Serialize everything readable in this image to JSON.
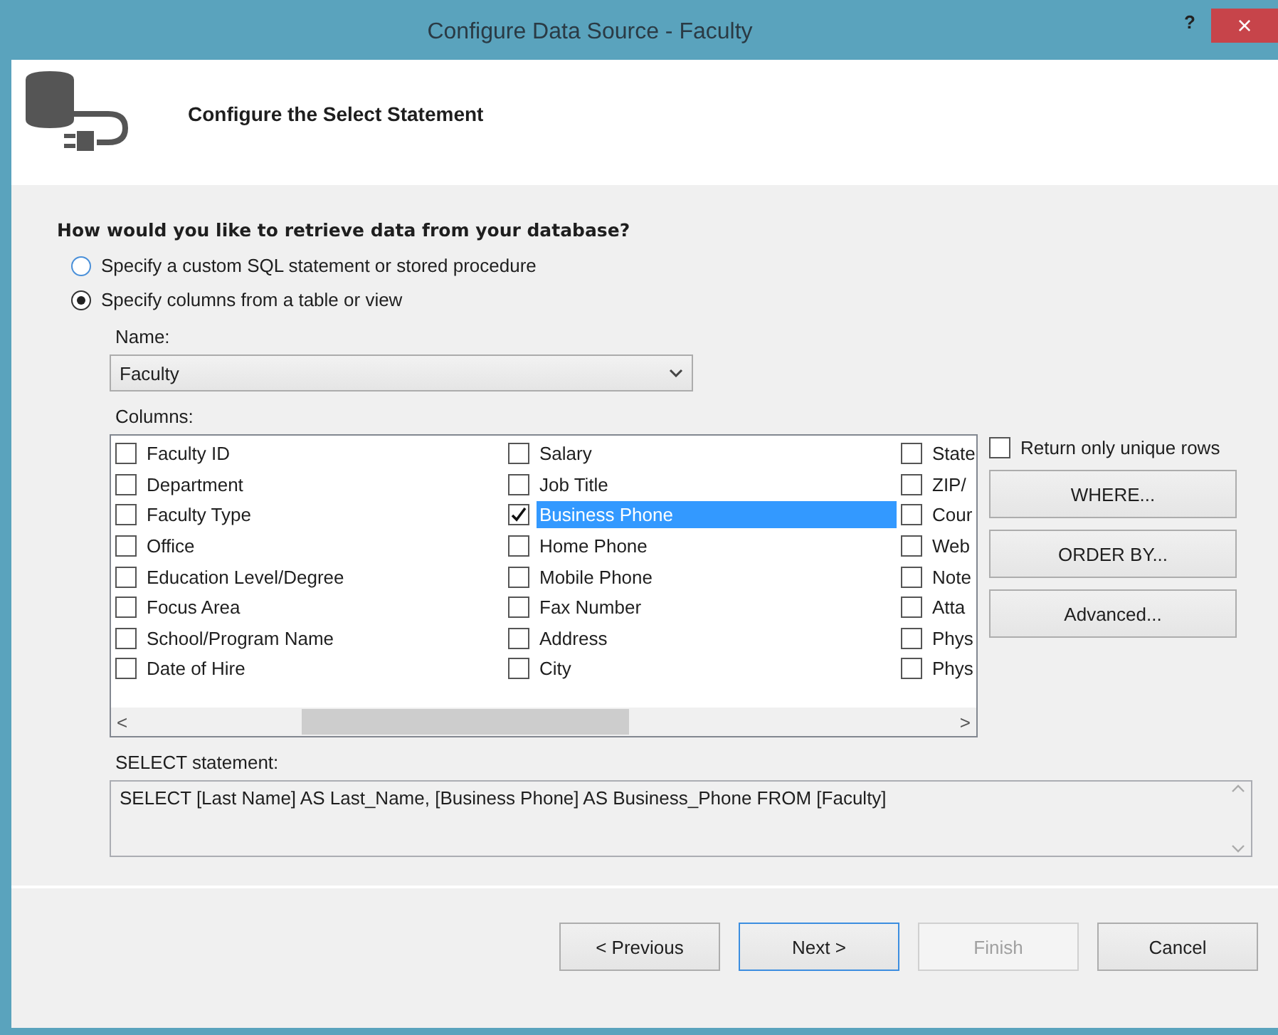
{
  "window": {
    "title": "Configure Data Source - Faculty",
    "help": "?",
    "close": "×"
  },
  "header": {
    "title": "Configure the Select Statement"
  },
  "question": "How would you like to retrieve data from your database?",
  "options": [
    {
      "label": "Specify a custom SQL statement or stored procedure",
      "selected": false
    },
    {
      "label": "Specify columns from a table or view",
      "selected": true
    }
  ],
  "name_label": "Name:",
  "name_field": {
    "value": "Faculty"
  },
  "columns_label": "Columns:",
  "columns": [
    [
      {
        "label": "Faculty ID",
        "checked": false,
        "selected": false
      },
      {
        "label": "Department",
        "checked": false,
        "selected": false
      },
      {
        "label": "Faculty Type",
        "checked": false,
        "selected": false
      },
      {
        "label": "Office",
        "checked": false,
        "selected": false
      },
      {
        "label": "Education Level/Degree",
        "checked": false,
        "selected": false
      },
      {
        "label": "Focus Area",
        "checked": false,
        "selected": false
      },
      {
        "label": "School/Program Name",
        "checked": false,
        "selected": false
      },
      {
        "label": "Date of Hire",
        "checked": false,
        "selected": false
      }
    ],
    [
      {
        "label": "Salary",
        "checked": false,
        "selected": false
      },
      {
        "label": "Job Title",
        "checked": false,
        "selected": false
      },
      {
        "label": "Business Phone",
        "checked": true,
        "selected": true
      },
      {
        "label": "Home Phone",
        "checked": false,
        "selected": false
      },
      {
        "label": "Mobile Phone",
        "checked": false,
        "selected": false
      },
      {
        "label": "Fax Number",
        "checked": false,
        "selected": false
      },
      {
        "label": "Address",
        "checked": false,
        "selected": false
      },
      {
        "label": "City",
        "checked": false,
        "selected": false
      }
    ],
    [
      {
        "label": "State",
        "checked": false,
        "selected": false
      },
      {
        "label": "ZIP/",
        "checked": false,
        "selected": false
      },
      {
        "label": "Cour",
        "checked": false,
        "selected": false
      },
      {
        "label": "Web",
        "checked": false,
        "selected": false
      },
      {
        "label": "Note",
        "checked": false,
        "selected": false
      },
      {
        "label": "Atta",
        "checked": false,
        "selected": false
      },
      {
        "label": "Phys",
        "checked": false,
        "selected": false
      },
      {
        "label": "Phys",
        "checked": false,
        "selected": false
      }
    ]
  ],
  "scroll": {
    "left": "<",
    "right": ">"
  },
  "unique_rows": {
    "label": "Return only unique rows",
    "checked": false
  },
  "side_buttons": [
    "WHERE...",
    "ORDER BY...",
    "Advanced..."
  ],
  "select_label": "SELECT statement:",
  "select_statement": "SELECT [Last Name] AS Last_Name, [Business Phone] AS Business_Phone FROM [Faculty]",
  "buttons": [
    {
      "label": "< Previous",
      "kind": "normal"
    },
    {
      "label": "Next >",
      "kind": "default"
    },
    {
      "label": "Finish",
      "kind": "disabled"
    },
    {
      "label": "Cancel",
      "kind": "normal"
    }
  ]
}
